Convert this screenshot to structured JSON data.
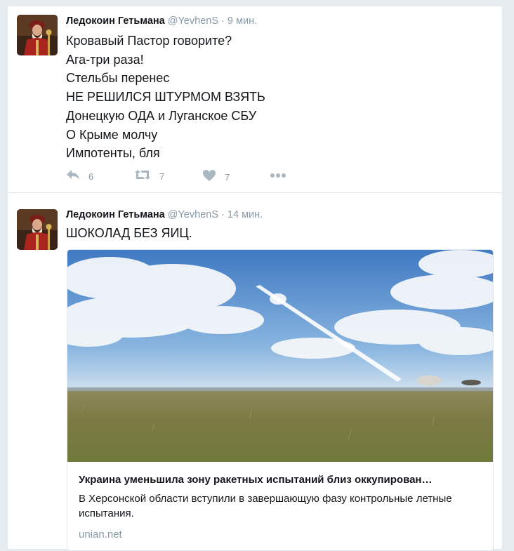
{
  "tweets": [
    {
      "fullname": "Ледокоин Гетьмана",
      "username": "@YevhenS",
      "separator": "·",
      "time": "9 мин.",
      "lines": [
        "Кровавый Пастор говорите?",
        "Ага-три раза!",
        "Стельбы перенес",
        "НЕ РЕШИЛСЯ ШТУРМОМ ВЗЯТЬ",
        "Донецкую ОДА и Луганское СБУ",
        "О Крыме молчу",
        "Импотенты, бля"
      ],
      "reply_count": "6",
      "retweet_count": "7",
      "like_count": "7"
    },
    {
      "fullname": "Ледокоин Гетьмана",
      "username": "@YevhenS",
      "separator": "·",
      "time": "14 мин.",
      "text": "ШОКОЛАД БЕЗ ЯИЦ.",
      "card": {
        "title": "Украина уменьшила зону ракетных испытаний близ оккупирован…",
        "description": "В Херсонской области вступили в завершающую фазу контрольные летные испытания.",
        "domain": "unian.net"
      }
    }
  ],
  "icons": {
    "reply": "reply-icon",
    "retweet": "retweet-icon",
    "like": "heart-icon",
    "more": "more-dots-icon"
  },
  "colors": {
    "background": "#e6ecf0",
    "text": "#14171a",
    "secondary": "#8899a6",
    "action_icon": "#aab8c2",
    "border": "#e1e8ed"
  }
}
